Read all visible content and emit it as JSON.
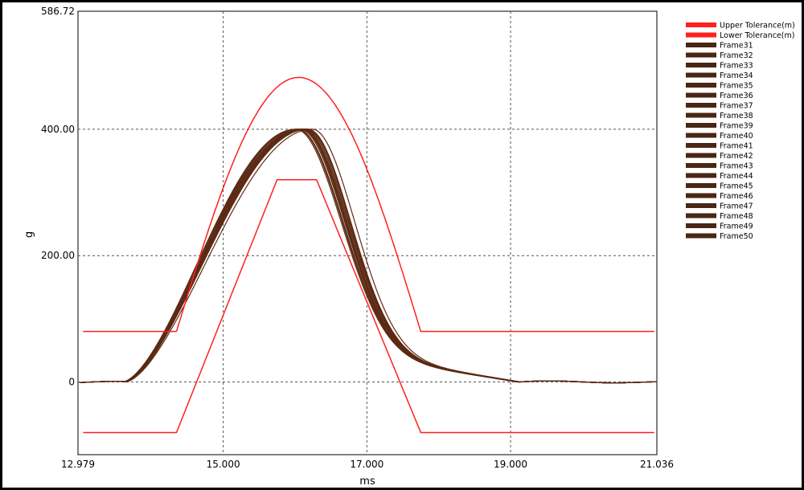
{
  "chart_data": {
    "type": "line",
    "xlabel": "ms",
    "ylabel": "g",
    "xlim": [
      12.979,
      21.036
    ],
    "ylim": [
      -115,
      586.72
    ],
    "x_ticks": [
      {
        "value": 12.979,
        "label": "12.979"
      },
      {
        "value": 15.0,
        "label": "15.000"
      },
      {
        "value": 17.0,
        "label": "17.000"
      },
      {
        "value": 19.0,
        "label": "19.000"
      },
      {
        "value": 21.036,
        "label": "21.036"
      }
    ],
    "y_ticks": [
      {
        "value": 586.72,
        "label": "586.72"
      },
      {
        "value": 400,
        "label": "400.00"
      },
      {
        "value": 200,
        "label": "200.00"
      },
      {
        "value": 0,
        "label": "0"
      }
    ],
    "grid": true,
    "legend_position": "right",
    "colors": {
      "tolerance": "#ff2020",
      "frames": "#5c2a14",
      "grid": "#555555"
    },
    "series": [
      {
        "name": "Upper Tolerance(m)",
        "kind": "tolerance",
        "x": [
          13.05,
          14.35,
          14.6,
          15.0,
          15.4,
          15.8,
          16.0,
          16.2,
          16.6,
          17.0,
          17.4,
          17.75,
          21.0
        ],
        "y": [
          80,
          80,
          182,
          339,
          440,
          480,
          482,
          480,
          440,
          339,
          182,
          80,
          80
        ]
      },
      {
        "name": "Lower Tolerance(m)",
        "kind": "tolerance",
        "x": [
          13.05,
          14.35,
          15.75,
          16.3,
          17.75,
          21.0
        ],
        "y": [
          -80,
          -80,
          320,
          320,
          -80,
          -80
        ]
      },
      {
        "name": "Frame31",
        "peak_x": 16.1
      },
      {
        "name": "Frame32",
        "peak_x": 16.02
      },
      {
        "name": "Frame33",
        "peak_x": 16.07
      },
      {
        "name": "Frame34",
        "peak_x": 16.14
      },
      {
        "name": "Frame35",
        "peak_x": 16.05
      },
      {
        "name": "Frame36",
        "peak_x": 16.18
      },
      {
        "name": "Frame37",
        "peak_x": 16.0
      },
      {
        "name": "Frame38",
        "peak_x": 16.12
      },
      {
        "name": "Frame39",
        "peak_x": 16.09
      },
      {
        "name": "Frame40",
        "peak_x": 16.2
      },
      {
        "name": "Frame41",
        "peak_x": 16.04
      },
      {
        "name": "Frame42",
        "peak_x": 16.16
      },
      {
        "name": "Frame43",
        "peak_x": 16.08
      },
      {
        "name": "Frame44",
        "peak_x": 16.13
      },
      {
        "name": "Frame45",
        "peak_x": 16.03
      },
      {
        "name": "Frame46",
        "peak_x": 16.11
      },
      {
        "name": "Frame47",
        "peak_x": 16.06
      },
      {
        "name": "Frame48",
        "peak_x": 16.15
      },
      {
        "name": "Frame49",
        "peak_x": 16.01
      },
      {
        "name": "Frame50",
        "peak_x": 16.1
      }
    ],
    "frame_shape": {
      "peak_y": 400,
      "start_x": 13.6,
      "end_x": 19.1
    }
  }
}
